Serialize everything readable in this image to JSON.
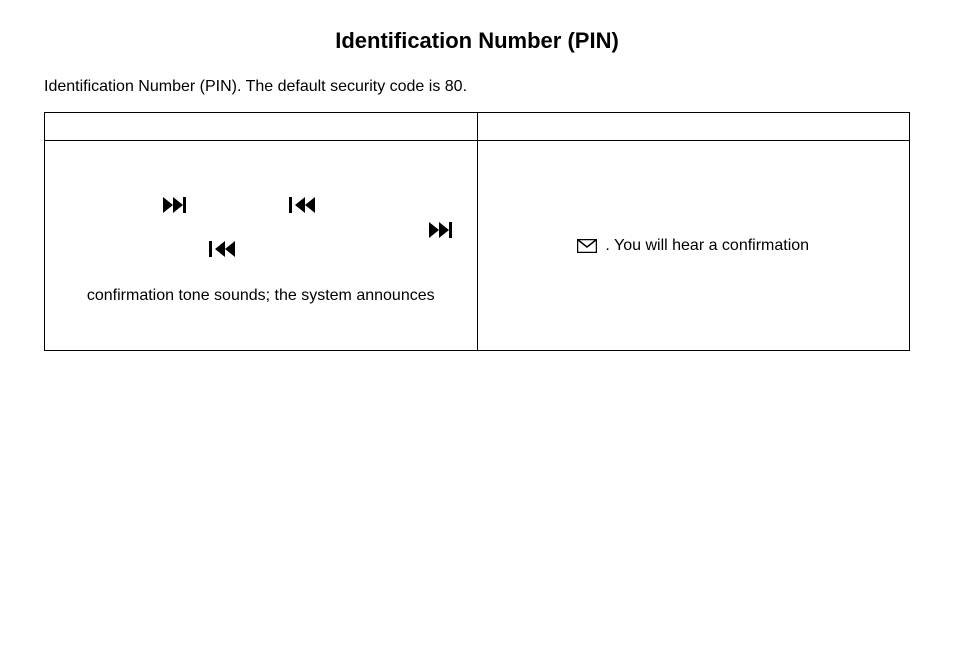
{
  "title": "Identification Number (PIN)",
  "intro": "Identification Number (PIN). The default security code is 80.",
  "table": {
    "left": {
      "text": "confirmation tone sounds; the system announces"
    },
    "right": {
      "text": ". You will hear a confirmation"
    }
  }
}
